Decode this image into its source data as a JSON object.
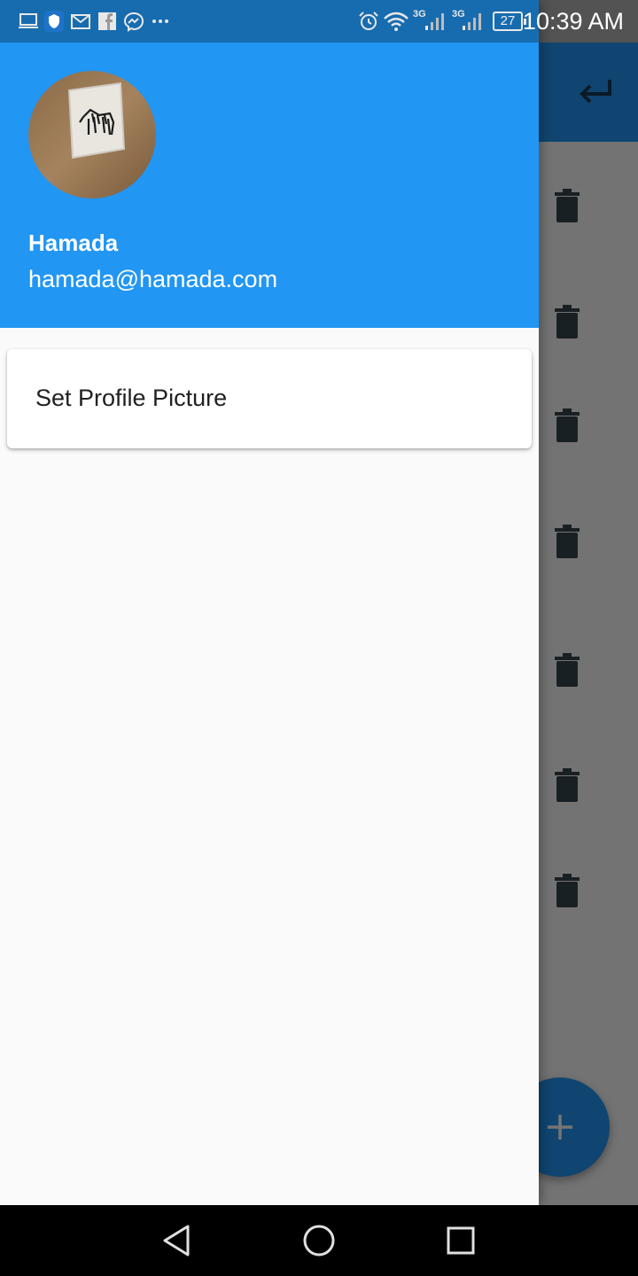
{
  "status_bar": {
    "time": "10:39 AM",
    "battery": "27",
    "network_1": "3G",
    "network_2": "3G",
    "left_icons": [
      "laptop-icon",
      "shield-app-icon",
      "gmail-icon",
      "facebook-icon",
      "messenger-icon",
      "more-dots-icon"
    ],
    "right_icons": [
      "alarm-icon",
      "wifi-icon",
      "signal-icon",
      "signal-icon",
      "battery-icon"
    ]
  },
  "drawer": {
    "user_name": "Hamada",
    "user_email": "hamada@hamada.com",
    "menu_items": [
      {
        "label": "Set Profile Picture"
      }
    ]
  },
  "app": {
    "header_icon": "back-arrow-icon",
    "row_action_icon": "trash-icon",
    "row_count": 7,
    "fab_icon": "add-icon"
  },
  "colors": {
    "primary": "#2196f3",
    "drawer_bg": "#fafafa",
    "nav_bar": "#000000"
  },
  "nav_bar": {
    "buttons": [
      "back-triangle-icon",
      "home-circle-icon",
      "recents-square-icon"
    ]
  }
}
